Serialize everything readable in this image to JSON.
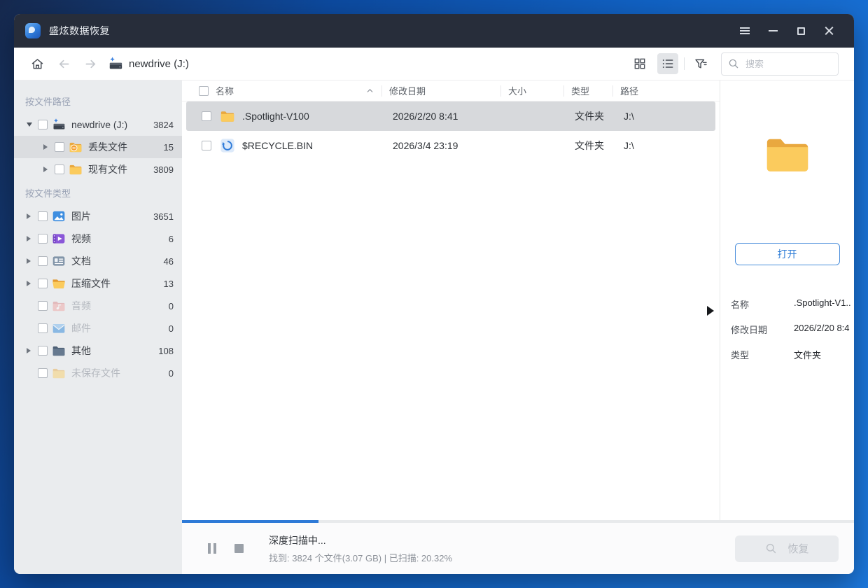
{
  "window": {
    "title": "盛炫数据恢复"
  },
  "titlebar": {
    "icons": [
      "app-logo",
      "menu",
      "minimize",
      "maximize",
      "close"
    ]
  },
  "toolbar": {
    "breadcrumb": "newdrive (J:)",
    "search_placeholder": "搜索",
    "icons": [
      "home",
      "back",
      "forward",
      "drive",
      "grid-view",
      "list-view",
      "filter",
      "search"
    ],
    "active_view": "list"
  },
  "sidebar": {
    "sections": [
      {
        "header": "按文件路径",
        "items": [
          {
            "label": "newdrive (J:)",
            "count": "3824",
            "icon": "drive",
            "expanded": true
          },
          {
            "label": "丢失文件",
            "count": "15",
            "icon": "folder-lost",
            "selected": true
          },
          {
            "label": "现有文件",
            "count": "3809",
            "icon": "folder"
          }
        ]
      },
      {
        "header": "按文件类型",
        "items": [
          {
            "label": "图片",
            "count": "3651",
            "icon": "image"
          },
          {
            "label": "视频",
            "count": "6",
            "icon": "video"
          },
          {
            "label": "文档",
            "count": "46",
            "icon": "document"
          },
          {
            "label": "压缩文件",
            "count": "13",
            "icon": "archive-folder"
          },
          {
            "label": "音频",
            "count": "0",
            "icon": "audio-folder",
            "disabled": true
          },
          {
            "label": "邮件",
            "count": "0",
            "icon": "mail",
            "disabled": true
          },
          {
            "label": "其他",
            "count": "108",
            "icon": "folder-dark"
          },
          {
            "label": "未保存文件",
            "count": "0",
            "icon": "folder-faded",
            "disabled": true
          }
        ]
      }
    ]
  },
  "filelist": {
    "columns": {
      "name": "名称",
      "modified": "修改日期",
      "size": "大小",
      "type": "类型",
      "path": "路径"
    },
    "sort": {
      "column": "名称",
      "direction": "asc"
    },
    "rows": [
      {
        "name": ".Spotlight-V100",
        "modified": "2026/2/20 8:41",
        "size": "",
        "type": "文件夹",
        "path": "J:\\",
        "icon": "folder",
        "selected": true
      },
      {
        "name": "$RECYCLE.BIN",
        "modified": "2026/3/4 23:19",
        "size": "",
        "type": "文件夹",
        "path": "J:\\",
        "icon": "recycle-bin",
        "selected": false
      }
    ]
  },
  "preview": {
    "thumbnail_icon": "folder",
    "open_button": "打开",
    "details": [
      {
        "label": "名称",
        "value": ".Spotlight-V1.."
      },
      {
        "label": "修改日期",
        "value": "2026/2/20 8:4"
      },
      {
        "label": "类型",
        "value": "文件夹"
      }
    ]
  },
  "statusbar": {
    "status_title": "深度扫描中...",
    "status_detail": "找到: 3824 个文件(3.07 GB) | 已扫描: 20.32%",
    "progress_percent": 20.32,
    "recover_label": "恢复",
    "icons": [
      "pause",
      "stop",
      "preview-search"
    ]
  },
  "colors": {
    "accent": "#2e7ad7",
    "titlebar": "#272d3a",
    "sidebar_bg": "#eaecee",
    "selection": "#d7d9dc",
    "desktop_blue": "#1162c4"
  }
}
